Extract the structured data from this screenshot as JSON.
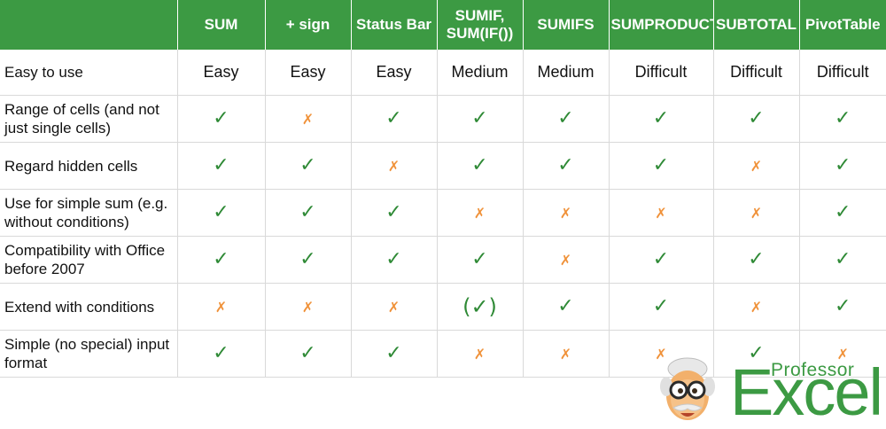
{
  "header": {
    "corner": "",
    "columns": [
      "SUM",
      "+ sign",
      "Status Bar",
      "SUMIF, SUM(IF())",
      "SUMIFS",
      "SUMPRODUCT",
      "SUBTOTAL",
      "PivotTable"
    ]
  },
  "rows": [
    {
      "label": "Easy to use",
      "values": [
        "Easy",
        "Easy",
        "Easy",
        "Medium",
        "Medium",
        "Difficult",
        "Difficult",
        "Difficult"
      ]
    },
    {
      "label": "Range of cells (and not just single cells)",
      "values": [
        "✓",
        "✗",
        "✓",
        "✓",
        "✓",
        "✓",
        "✓",
        "✓"
      ]
    },
    {
      "label": "Regard hidden cells",
      "values": [
        "✓",
        "✓",
        "✗",
        "✓",
        "✓",
        "✓",
        "✗",
        "✓"
      ]
    },
    {
      "label": "Use for simple sum (e.g. without conditions)",
      "values": [
        "✓",
        "✓",
        "✓",
        "✗",
        "✗",
        "✗",
        "✗",
        "✓"
      ]
    },
    {
      "label": "Compatibility with Office before 2007",
      "values": [
        "✓",
        "✓",
        "✓",
        "✓",
        "✗",
        "✓",
        "✓",
        "✓"
      ]
    },
    {
      "label": "Extend with conditions",
      "values": [
        "✗",
        "✗",
        "✗",
        "(✓)",
        "✓",
        "✓",
        "✗",
        "✓"
      ]
    },
    {
      "label": "Simple (no special) input format",
      "values": [
        "✓",
        "✓",
        "✓",
        "✗",
        "✗",
        "✗",
        "✓",
        "✗"
      ]
    }
  ],
  "marks": {
    "yes": "✓",
    "no": "✗",
    "partial": "(✓)"
  },
  "colors": {
    "header_bg": "#3c9a43",
    "header_text": "#ffffff",
    "check": "#2f8a36",
    "cross": "#f0923a",
    "grid": "#d9d9d9"
  },
  "logo": {
    "word_small": "Professor",
    "word_big": "Excel",
    "icon": "professor-face-icon"
  }
}
